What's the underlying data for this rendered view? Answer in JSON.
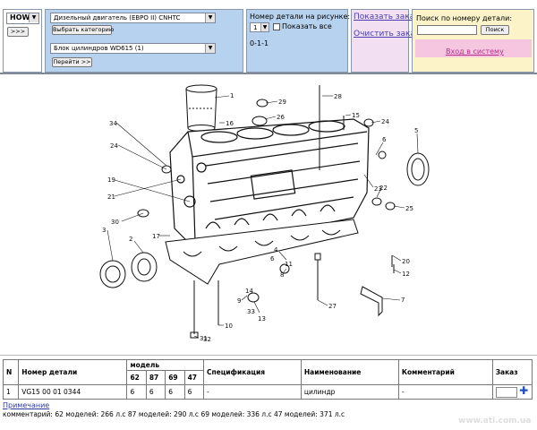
{
  "brand": {
    "select_value": "HOWO",
    "go_button": ">>>"
  },
  "catalog": {
    "engine_select": "Дизельный двигатель (ЕВРО II) CNHTC",
    "category_button": "Выбрать категорию",
    "assembly_select": "Блок цилиндров WD615 (1)",
    "go_button": "Перейти >>"
  },
  "part_number_panel": {
    "title": "Номер детали на рисунке:",
    "number_value": "1",
    "show_all_label": "Показать все",
    "part_code": "0-1-1"
  },
  "links": {
    "show_order": "Показать заказ",
    "clear_order": "Очистить заказ"
  },
  "search": {
    "title": "Поиск по номеру детали:",
    "search_button": "Поиск",
    "login_link": "Вход в систему"
  },
  "callouts": [
    "1",
    "16",
    "29",
    "26",
    "28",
    "15",
    "24",
    "34",
    "24",
    "5",
    "6",
    "19",
    "21",
    "22",
    "23",
    "30",
    "25",
    "3",
    "2",
    "17",
    "20",
    "4",
    "12",
    "8",
    "7",
    "13",
    "27",
    "10",
    "31",
    "32",
    "33",
    "9",
    "6",
    "11",
    "14"
  ],
  "table": {
    "headers": {
      "n": "N",
      "part_number": "Номер детали",
      "models": "модель",
      "spec": "Спецификация",
      "name": "Наименование",
      "comment": "Комментарий",
      "order": "Заказ"
    },
    "model_columns": [
      "62",
      "87",
      "69",
      "47"
    ],
    "rows": [
      {
        "n": "1",
        "part_number": "VG15 00 01 0344",
        "models": [
          "6",
          "6",
          "6",
          "6"
        ],
        "spec": "-",
        "name": "цилиндр",
        "comment": "-"
      }
    ]
  },
  "footer": {
    "note_link": "Примечание",
    "note_text": "комментарий: 62 моделей: 266 л.с 87 моделей: 290 л.с 69 моделей: 336 л.с 47 моделей: 371 л.с",
    "watermark": "www.ati.com.ua"
  },
  "colors": {
    "panel_blue": "#b7d2ee",
    "panel_pink": "#f2dff2",
    "panel_yellow": "#fcf4c8",
    "login_bg": "#f6c6e0",
    "link": "#4a3fae",
    "add_icon": "#1f4fc4"
  }
}
